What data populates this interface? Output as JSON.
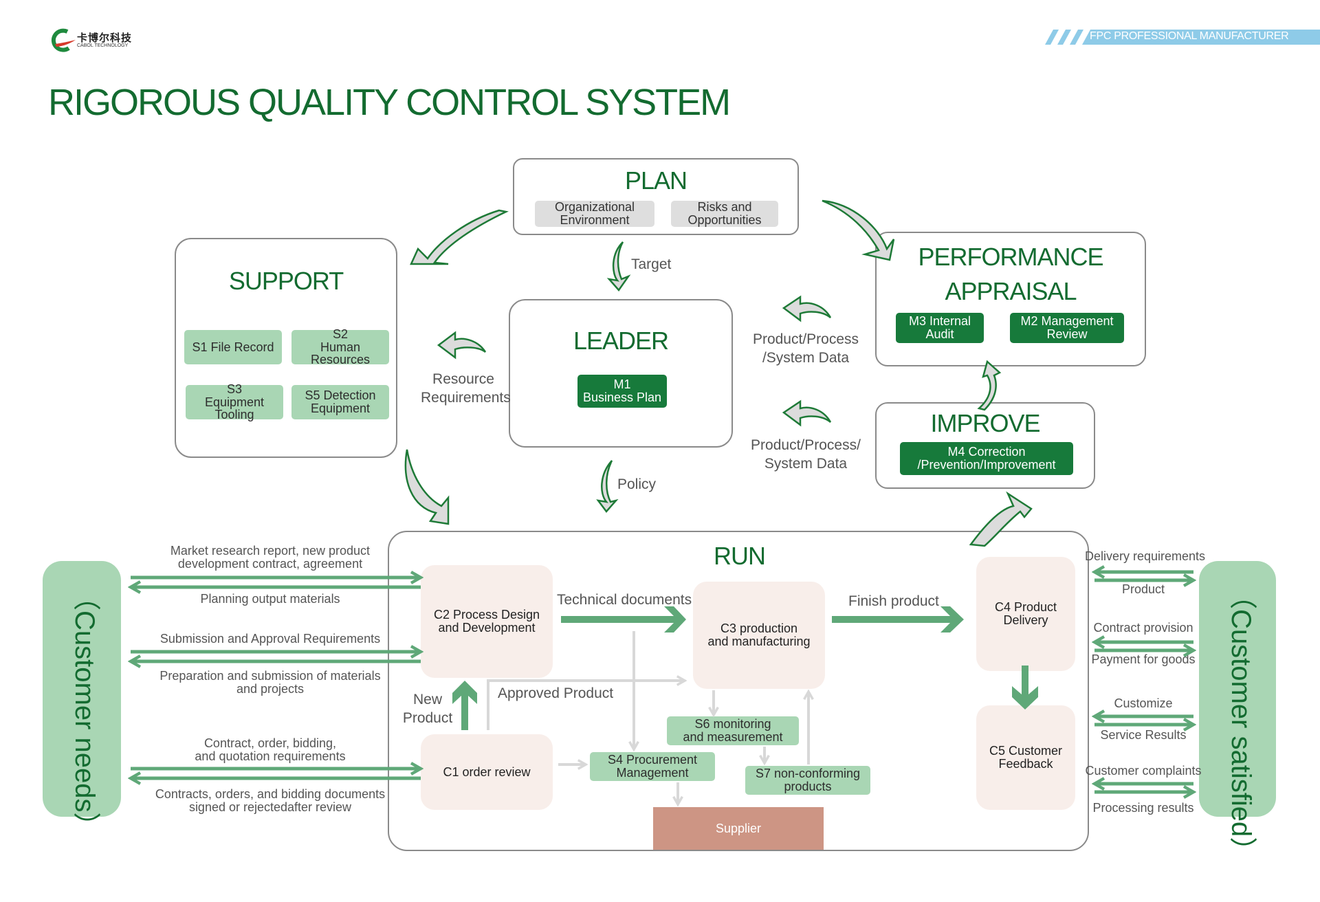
{
  "header": {
    "logo_cn": "卡博尔科技",
    "logo_en": "CABOL TECHNOLOGY",
    "logo_mark": "capol",
    "banner": "FPC PROFESSIONAL MANUFACTURER",
    "title": "RIGOROUS QUALITY CONTROL SYSTEM"
  },
  "colors": {
    "brand_green": "#136b30",
    "dark_chip": "#177a3b",
    "light_chip": "#a9d6b4",
    "flow_arrow": "#5fa878",
    "process_bg": "#f8eeea",
    "supplier": "#cd9584",
    "banner_blue": "#8ecbe8",
    "cycle_arrow_fill": "#dcdcdc"
  },
  "plan": {
    "title": "PLAN",
    "items": [
      "Organizational\nEnvironment",
      "Risks and\nOpportunities"
    ]
  },
  "support": {
    "title": "SUPPORT",
    "items": [
      {
        "code": "S1",
        "label": "S1 File Record"
      },
      {
        "code": "S2",
        "label": "S2\nHuman Resources"
      },
      {
        "code": "S3",
        "label": "S3\nEquipment Tooling"
      },
      {
        "code": "S5",
        "label": "S5 Detection\nEquipment"
      }
    ]
  },
  "leader": {
    "title": "LEADER",
    "item": "M1\nBusiness Plan"
  },
  "performance": {
    "title_line1": "PERFORMANCE",
    "title_line2": "APPRAISAL",
    "items": [
      "M3 Internal\nAudit",
      "M2 Management\nReview"
    ]
  },
  "improve": {
    "title": "IMPROVE",
    "item": "M4 Correction\n/Prevention/Improvement"
  },
  "connectors": {
    "target": "Target",
    "policy": "Policy",
    "resource_requirements": "Resource\nRequirements",
    "data_upper": "Product/Process\n/System Data",
    "data_lower": "Product/Process/\nSystem Data"
  },
  "run": {
    "title": "RUN",
    "c1": "C1 order review",
    "c2": "C2 Process Design\nand Development",
    "c3": "C3 production\nand manufacturing",
    "c4": "C4 Product\nDelivery",
    "c5": "C5 Customer\nFeedback",
    "s4": "S4 Procurement\nManagement",
    "s6": "S6 monitoring\nand measurement",
    "s7": "S7 non-conforming\nproducts",
    "supplier": "Supplier",
    "technical_documents": "Technical documents",
    "finish_product": "Finish product",
    "approved_product": "Approved Product",
    "new_product": "New\nProduct"
  },
  "customer_needs": {
    "label": "（Customer needs）",
    "flows": [
      {
        "in": "Market research report, new product\ndevelopment contract, agreement",
        "out": "Planning output materials"
      },
      {
        "in": "Submission and Approval Requirements",
        "out": "Preparation and submission of materials\nand projects"
      },
      {
        "in": "Contract, order, bidding,\nand quotation requirements",
        "out": "Contracts, orders, and bidding documents\nsigned or rejectedafter review"
      }
    ]
  },
  "customer_satisfied": {
    "label": "（Customer satisfied）",
    "flows": [
      {
        "top": "Delivery requirements",
        "bottom": "Product"
      },
      {
        "top": "Contract provision",
        "bottom": "Payment for goods"
      },
      {
        "top": "Customize",
        "bottom": "Service Results"
      },
      {
        "top": "Customer complaints",
        "bottom": "Processing results"
      }
    ]
  }
}
